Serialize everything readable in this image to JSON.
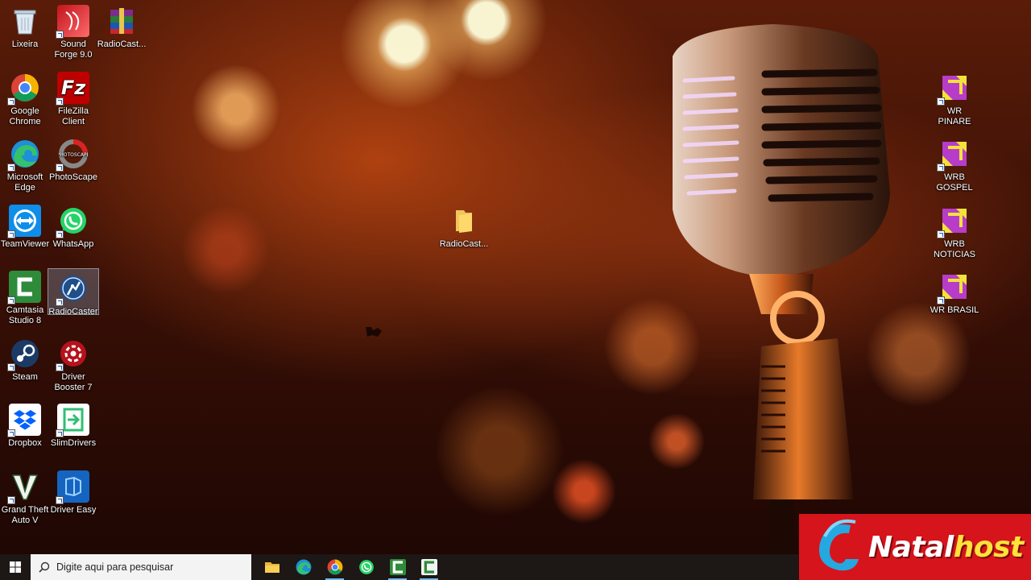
{
  "desktop": {
    "icons_left": [
      {
        "id": "lixeira",
        "label": "Lixeira"
      },
      {
        "id": "sound-forge",
        "label": "Sound\nForge 9.0"
      },
      {
        "id": "radiocast-rar",
        "label": "RadioCast..."
      },
      {
        "id": "chrome",
        "label": "Google\nChrome"
      },
      {
        "id": "filezilla",
        "label": "FileZilla\nClient"
      },
      {
        "id": "edge",
        "label": "Microsoft\nEdge"
      },
      {
        "id": "photoscape",
        "label": "PhotoScape"
      },
      {
        "id": "teamviewer",
        "label": "TeamViewer"
      },
      {
        "id": "whatsapp",
        "label": "WhatsApp"
      },
      {
        "id": "camtasia",
        "label": "Camtasia\nStudio 8"
      },
      {
        "id": "radiocaster",
        "label": "RadioCaster"
      },
      {
        "id": "steam",
        "label": "Steam"
      },
      {
        "id": "driver-booster",
        "label": "Driver\nBooster 7"
      },
      {
        "id": "dropbox",
        "label": "Dropbox"
      },
      {
        "id": "slimdrivers",
        "label": "SlimDrivers"
      },
      {
        "id": "gta",
        "label": "Grand Theft\nAuto V"
      },
      {
        "id": "driver-easy",
        "label": "Driver Easy"
      }
    ],
    "folder_center": {
      "label": "RadioCast..."
    },
    "icons_right": [
      {
        "label": "WR PINARE"
      },
      {
        "label": "WRB\nGOSPEL"
      },
      {
        "label": "WRB\nNOTICIAS"
      },
      {
        "label": "WR BRASIL"
      }
    ]
  },
  "taskbar": {
    "search_placeholder": "Digite aqui para pesquisar",
    "apps": [
      "file-explorer",
      "edge",
      "chrome",
      "whatsapp",
      "camtasia",
      "camtasia-recorder"
    ]
  },
  "brand": {
    "text_a": "Natal",
    "text_b": "host"
  },
  "colors": {
    "taskbar": "#1d1715",
    "brand_red": "#d6141c",
    "brand_yellow": "#ffe23a",
    "accent": "#76b9ed"
  }
}
